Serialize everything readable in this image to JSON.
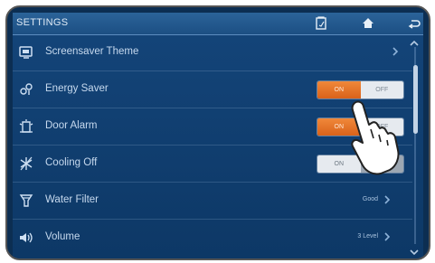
{
  "header": {
    "title": "SETTINGS"
  },
  "rows": [
    {
      "label": "Screensaver Theme"
    },
    {
      "label": "Energy Saver",
      "on_label": "ON",
      "off_label": "OFF"
    },
    {
      "label": "Door Alarm",
      "on_label": "ON",
      "off_label": "OFF"
    },
    {
      "label": "Cooling Off",
      "on_label": "ON",
      "off_label": "OFF"
    },
    {
      "label": "Water Filter",
      "value": "Good"
    },
    {
      "label": "Volume",
      "value": "3 Level"
    }
  ],
  "icons": {
    "header": [
      "clipboard-icon",
      "home-icon",
      "back-icon"
    ],
    "rows": [
      "screensaver-icon",
      "energy-saver-icon",
      "door-alarm-icon",
      "cooling-off-icon",
      "water-filter-icon",
      "volume-icon"
    ]
  },
  "colors": {
    "accent": "#e8752a",
    "header": "#1f5489",
    "background": "#0f3b6b"
  }
}
